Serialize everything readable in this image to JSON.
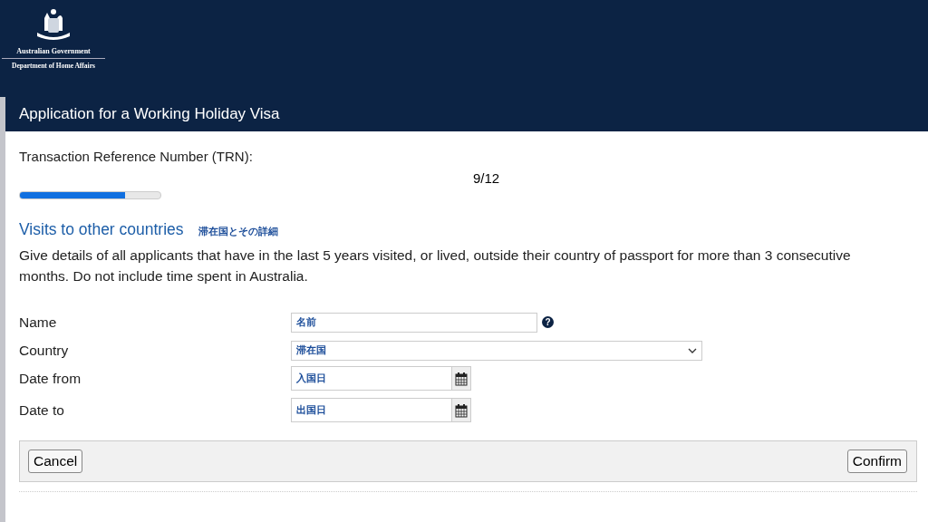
{
  "header": {
    "logo_line_1": "Australian Government",
    "logo_line_2": "Department of Home Affairs"
  },
  "title": "Application for a Working Holiday Visa",
  "trn_label": "Transaction Reference Number (TRN):",
  "progress": {
    "text": "9/12",
    "level": 0.75
  },
  "section": {
    "heading": "Visits to other countries",
    "note": "滞在国とその詳細",
    "description": "Give details of all applicants that have in the last 5 years visited, or lived, outside their country of passport for more than 3 consecutive months. Do not include time spent in Australia."
  },
  "fields": [
    {
      "label": "Name",
      "kind": "text",
      "value": "名前",
      "help": "?"
    },
    {
      "label": "Country",
      "kind": "select",
      "value": "滞在国"
    },
    {
      "label": "Date from",
      "kind": "date",
      "value": "入国日"
    },
    {
      "label": "Date to",
      "kind": "date",
      "value": "出国日"
    }
  ],
  "buttons": {
    "cancel": "Cancel",
    "confirm": "Confirm"
  }
}
